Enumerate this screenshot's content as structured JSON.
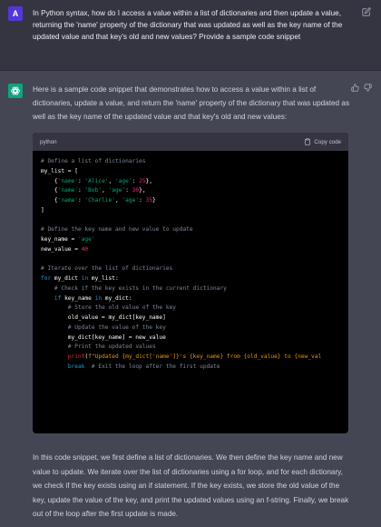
{
  "user": {
    "avatar_letter": "A",
    "message": "In Python syntax, how do I access a value within a list of dictionaries and then update a value, returning the 'name' property of the dictionary that was updated as well as the key name of the updated value and that key's old and new values? Provide a sample code snippet"
  },
  "assistant": {
    "intro": "Here is a sample code snippet that demonstrates how to access a value within a list of dictionaries, update a value, and return the 'name' property of the dictionary that was updated as well as the key name of the updated value and that key's old and new values:",
    "code": {
      "language": "python",
      "copy_label": "Copy code",
      "lines": [
        [
          [
            "c-com",
            "# Define a list of dictionaries"
          ]
        ],
        [
          [
            "",
            "my_list = ["
          ]
        ],
        [
          [
            "",
            "    {"
          ],
          [
            "c-str",
            "'name'"
          ],
          [
            "",
            ": "
          ],
          [
            "c-str",
            "'Alice'"
          ],
          [
            "",
            ", "
          ],
          [
            "c-str",
            "'age'"
          ],
          [
            "",
            ": "
          ],
          [
            "c-num",
            "25"
          ],
          [
            "",
            "},"
          ]
        ],
        [
          [
            "",
            "    {"
          ],
          [
            "c-str",
            "'name'"
          ],
          [
            "",
            ": "
          ],
          [
            "c-str",
            "'Bob'"
          ],
          [
            "",
            ", "
          ],
          [
            "c-str",
            "'age'"
          ],
          [
            "",
            ": "
          ],
          [
            "c-num",
            "30"
          ],
          [
            "",
            "},"
          ]
        ],
        [
          [
            "",
            "    {"
          ],
          [
            "c-str",
            "'name'"
          ],
          [
            "",
            ": "
          ],
          [
            "c-str",
            "'Charlie'"
          ],
          [
            "",
            ", "
          ],
          [
            "c-str",
            "'age'"
          ],
          [
            "",
            ": "
          ],
          [
            "c-num",
            "35"
          ],
          [
            "",
            "}"
          ]
        ],
        [
          [
            "",
            "]"
          ]
        ],
        [
          [
            "",
            ""
          ]
        ],
        [
          [
            "c-com",
            "# Define the key name and new value to update"
          ]
        ],
        [
          [
            "",
            "key_name = "
          ],
          [
            "c-str",
            "'age'"
          ]
        ],
        [
          [
            "",
            "new_value = "
          ],
          [
            "c-num",
            "40"
          ]
        ],
        [
          [
            "",
            ""
          ]
        ],
        [
          [
            "c-com",
            "# Iterate over the list of dictionaries"
          ]
        ],
        [
          [
            "c-kw",
            "for"
          ],
          [
            "",
            " my_dict "
          ],
          [
            "c-kw",
            "in"
          ],
          [
            "",
            " my_list:"
          ]
        ],
        [
          [
            "",
            "    "
          ],
          [
            "c-com",
            "# Check if the key exists in the current dictionary"
          ]
        ],
        [
          [
            "",
            "    "
          ],
          [
            "c-kw",
            "if"
          ],
          [
            "",
            " key_name "
          ],
          [
            "c-kw",
            "in"
          ],
          [
            "",
            " my_dict:"
          ]
        ],
        [
          [
            "",
            "        "
          ],
          [
            "c-com",
            "# Store the old value of the key"
          ]
        ],
        [
          [
            "",
            "        old_value = my_dict[key_name]"
          ]
        ],
        [
          [
            "",
            "        "
          ],
          [
            "c-com",
            "# Update the value of the key"
          ]
        ],
        [
          [
            "",
            "        my_dict[key_name] = new_value"
          ]
        ],
        [
          [
            "",
            "        "
          ],
          [
            "c-com",
            "# Print the updated values"
          ]
        ],
        [
          [
            "",
            "        "
          ],
          [
            "c-fn",
            "print"
          ],
          [
            "",
            "("
          ],
          [
            "c-fstr",
            "f\"Updated {my_dict['name']}'s {key_name} from {old_value} to {new_val"
          ]
        ],
        [
          [
            "",
            "        "
          ],
          [
            "c-kw",
            "break"
          ],
          [
            "",
            "  "
          ],
          [
            "c-com",
            "# Exit the loop after the first update"
          ]
        ]
      ]
    },
    "summary": "In this code snippet, we first define a list of dictionaries. We then define the key name and new value to update. We iterate over the list of dictionaries using a for loop, and for each dictionary, we check if the key exists using an if statement. If the key exists, we store the old value of the key, update the value of the key, and print the updated values using an f-string. Finally, we break out of the loop after the first update is made."
  },
  "colors": {
    "user_bg": "#343541",
    "assistant_bg": "#444654",
    "assistant_avatar": "#10a37f",
    "user_avatar": "#5436da"
  },
  "icons": [
    "edit-icon",
    "thumbs-up-icon",
    "thumbs-down-icon",
    "clipboard-icon",
    "openai-logo-icon"
  ]
}
